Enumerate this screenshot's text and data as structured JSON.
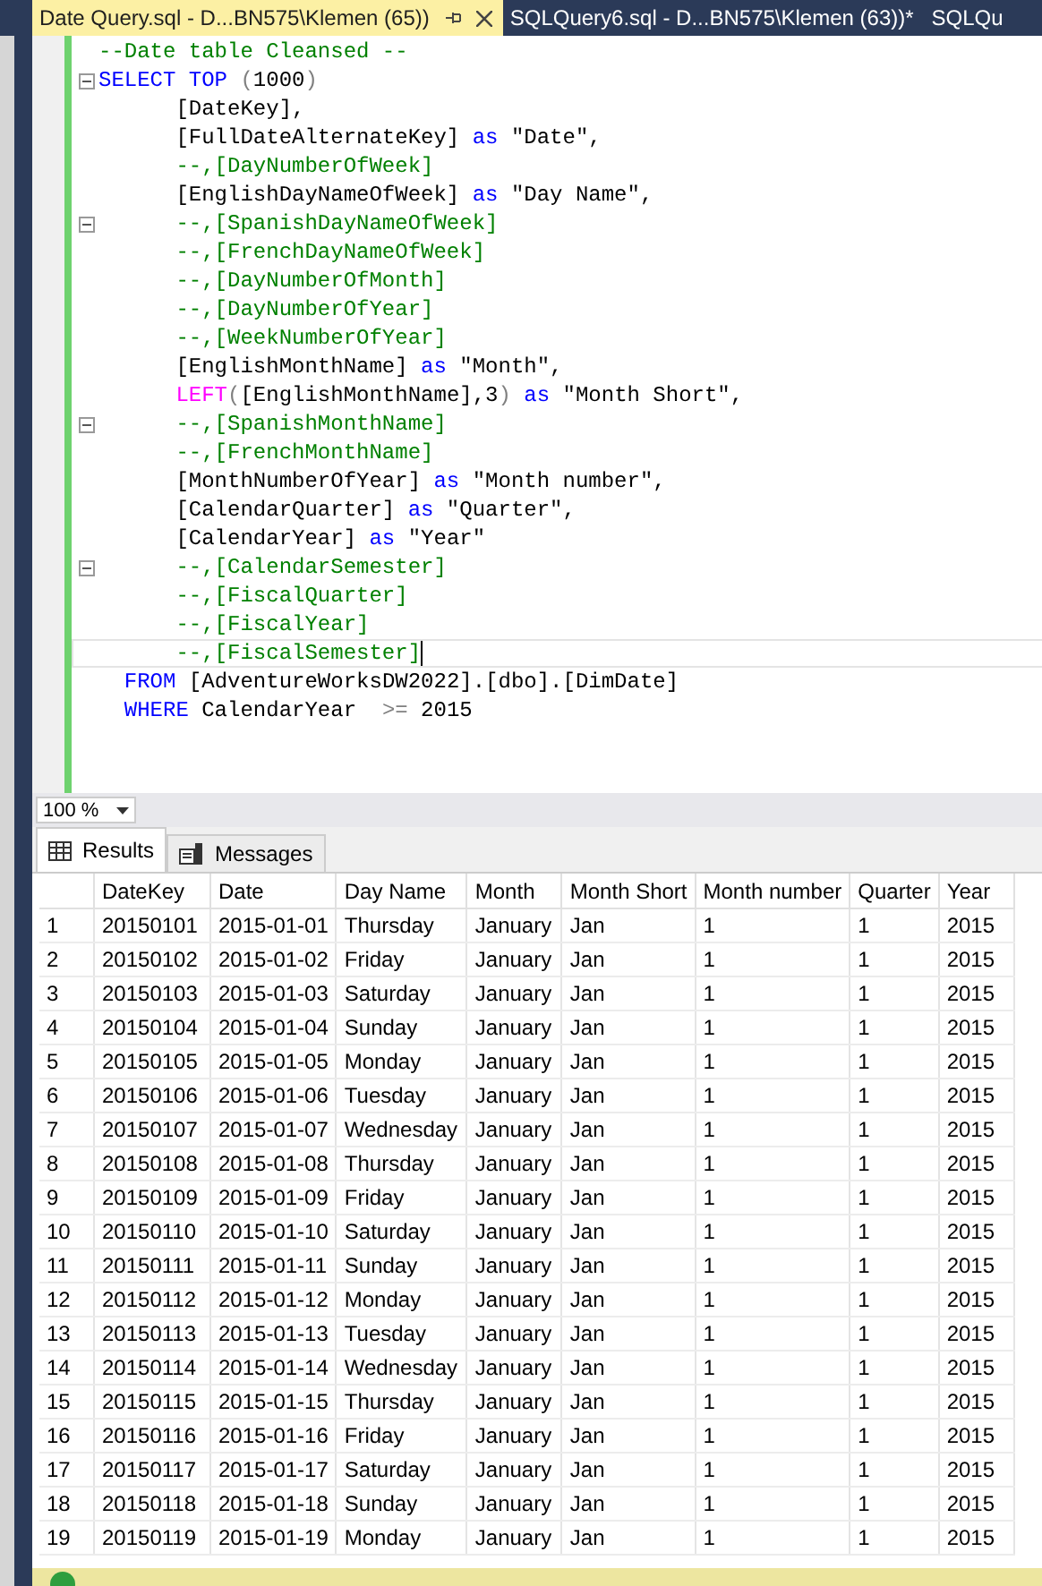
{
  "tabs": [
    {
      "label": "Date Query.sql - D...BN575\\Klemen (65))",
      "selected": true
    },
    {
      "label": "SQLQuery6.sql - D...BN575\\Klemen (63))*",
      "selected": false
    },
    {
      "label": "SQLQu",
      "selected": false
    }
  ],
  "editor": {
    "lines": [
      {
        "fold": false,
        "current": false,
        "segments": [
          {
            "kind": "comment",
            "text": "--Date table Cleansed --"
          }
        ]
      },
      {
        "fold": true,
        "current": false,
        "segments": [
          {
            "kind": "keyword",
            "text": "SELECT TOP "
          },
          {
            "kind": "op",
            "text": "("
          },
          {
            "kind": "text",
            "text": "1000"
          },
          {
            "kind": "op",
            "text": ")"
          }
        ]
      },
      {
        "fold": false,
        "current": false,
        "segments": [
          {
            "kind": "text",
            "text": "      [DateKey],"
          }
        ]
      },
      {
        "fold": false,
        "current": false,
        "segments": [
          {
            "kind": "text",
            "text": "      [FullDateAlternateKey] "
          },
          {
            "kind": "keyword",
            "text": "as"
          },
          {
            "kind": "text",
            "text": " \"Date\","
          }
        ]
      },
      {
        "fold": false,
        "current": false,
        "segments": [
          {
            "kind": "comment",
            "text": "      --,[DayNumberOfWeek]"
          }
        ]
      },
      {
        "fold": false,
        "current": false,
        "segments": [
          {
            "kind": "text",
            "text": "      [EnglishDayNameOfWeek] "
          },
          {
            "kind": "keyword",
            "text": "as"
          },
          {
            "kind": "text",
            "text": " \"Day Name\","
          }
        ]
      },
      {
        "fold": true,
        "current": false,
        "segments": [
          {
            "kind": "comment",
            "text": "      --,[SpanishDayNameOfWeek]"
          }
        ]
      },
      {
        "fold": false,
        "current": false,
        "segments": [
          {
            "kind": "comment",
            "text": "      --,[FrenchDayNameOfWeek]"
          }
        ]
      },
      {
        "fold": false,
        "current": false,
        "segments": [
          {
            "kind": "comment",
            "text": "      --,[DayNumberOfMonth]"
          }
        ]
      },
      {
        "fold": false,
        "current": false,
        "segments": [
          {
            "kind": "comment",
            "text": "      --,[DayNumberOfYear]"
          }
        ]
      },
      {
        "fold": false,
        "current": false,
        "segments": [
          {
            "kind": "comment",
            "text": "      --,[WeekNumberOfYear]"
          }
        ]
      },
      {
        "fold": false,
        "current": false,
        "segments": [
          {
            "kind": "text",
            "text": "      [EnglishMonthName] "
          },
          {
            "kind": "keyword",
            "text": "as"
          },
          {
            "kind": "text",
            "text": " \"Month\","
          }
        ]
      },
      {
        "fold": false,
        "current": false,
        "segments": [
          {
            "kind": "func",
            "text": "      LEFT"
          },
          {
            "kind": "op",
            "text": "("
          },
          {
            "kind": "text",
            "text": "[EnglishMonthName],3"
          },
          {
            "kind": "op",
            "text": ")"
          },
          {
            "kind": "keyword",
            "text": " as"
          },
          {
            "kind": "text",
            "text": " \"Month Short\","
          }
        ]
      },
      {
        "fold": true,
        "current": false,
        "segments": [
          {
            "kind": "comment",
            "text": "      --,[SpanishMonthName]"
          }
        ]
      },
      {
        "fold": false,
        "current": false,
        "segments": [
          {
            "kind": "comment",
            "text": "      --,[FrenchMonthName]"
          }
        ]
      },
      {
        "fold": false,
        "current": false,
        "segments": [
          {
            "kind": "text",
            "text": "      [MonthNumberOfYear] "
          },
          {
            "kind": "keyword",
            "text": "as"
          },
          {
            "kind": "text",
            "text": " \"Month number\","
          }
        ]
      },
      {
        "fold": false,
        "current": false,
        "segments": [
          {
            "kind": "text",
            "text": "      [CalendarQuarter] "
          },
          {
            "kind": "keyword",
            "text": "as"
          },
          {
            "kind": "text",
            "text": " \"Quarter\","
          }
        ]
      },
      {
        "fold": false,
        "current": false,
        "segments": [
          {
            "kind": "text",
            "text": "      [CalendarYear] "
          },
          {
            "kind": "keyword",
            "text": "as"
          },
          {
            "kind": "text",
            "text": " \"Year\""
          }
        ]
      },
      {
        "fold": true,
        "current": false,
        "segments": [
          {
            "kind": "comment",
            "text": "      --,[CalendarSemester]"
          }
        ]
      },
      {
        "fold": false,
        "current": false,
        "segments": [
          {
            "kind": "comment",
            "text": "      --,[FiscalQuarter]"
          }
        ]
      },
      {
        "fold": false,
        "current": false,
        "segments": [
          {
            "kind": "comment",
            "text": "      --,[FiscalYear]"
          }
        ]
      },
      {
        "fold": false,
        "current": true,
        "segments": [
          {
            "kind": "comment",
            "text": "      --,[FiscalSemester]"
          }
        ]
      },
      {
        "fold": false,
        "current": false,
        "segments": [
          {
            "kind": "keyword",
            "text": "  FROM "
          },
          {
            "kind": "text",
            "text": "[AdventureWorksDW2022].[dbo].[DimDate]"
          }
        ]
      },
      {
        "fold": false,
        "current": false,
        "segments": [
          {
            "kind": "keyword",
            "text": "  WHERE "
          },
          {
            "kind": "text",
            "text": "CalendarYear  "
          },
          {
            "kind": "op",
            "text": ">="
          },
          {
            "kind": "text",
            "text": " 2015"
          }
        ]
      }
    ]
  },
  "zoom": {
    "value": "100 %"
  },
  "result_tabs": [
    {
      "label": "Results",
      "kind": "grid",
      "selected": true
    },
    {
      "label": "Messages",
      "kind": "messages",
      "selected": false
    }
  ],
  "table": {
    "columns": [
      "",
      "DateKey",
      "Date",
      "Day Name",
      "Month",
      "Month Short",
      "Month number",
      "Quarter",
      "Year"
    ],
    "rows": [
      [
        "1",
        "20150101",
        "2015-01-01",
        "Thursday",
        "January",
        "Jan",
        "1",
        "1",
        "2015"
      ],
      [
        "2",
        "20150102",
        "2015-01-02",
        "Friday",
        "January",
        "Jan",
        "1",
        "1",
        "2015"
      ],
      [
        "3",
        "20150103",
        "2015-01-03",
        "Saturday",
        "January",
        "Jan",
        "1",
        "1",
        "2015"
      ],
      [
        "4",
        "20150104",
        "2015-01-04",
        "Sunday",
        "January",
        "Jan",
        "1",
        "1",
        "2015"
      ],
      [
        "5",
        "20150105",
        "2015-01-05",
        "Monday",
        "January",
        "Jan",
        "1",
        "1",
        "2015"
      ],
      [
        "6",
        "20150106",
        "2015-01-06",
        "Tuesday",
        "January",
        "Jan",
        "1",
        "1",
        "2015"
      ],
      [
        "7",
        "20150107",
        "2015-01-07",
        "Wednesday",
        "January",
        "Jan",
        "1",
        "1",
        "2015"
      ],
      [
        "8",
        "20150108",
        "2015-01-08",
        "Thursday",
        "January",
        "Jan",
        "1",
        "1",
        "2015"
      ],
      [
        "9",
        "20150109",
        "2015-01-09",
        "Friday",
        "January",
        "Jan",
        "1",
        "1",
        "2015"
      ],
      [
        "10",
        "20150110",
        "2015-01-10",
        "Saturday",
        "January",
        "Jan",
        "1",
        "1",
        "2015"
      ],
      [
        "11",
        "20150111",
        "2015-01-11",
        "Sunday",
        "January",
        "Jan",
        "1",
        "1",
        "2015"
      ],
      [
        "12",
        "20150112",
        "2015-01-12",
        "Monday",
        "January",
        "Jan",
        "1",
        "1",
        "2015"
      ],
      [
        "13",
        "20150113",
        "2015-01-13",
        "Tuesday",
        "January",
        "Jan",
        "1",
        "1",
        "2015"
      ],
      [
        "14",
        "20150114",
        "2015-01-14",
        "Wednesday",
        "January",
        "Jan",
        "1",
        "1",
        "2015"
      ],
      [
        "15",
        "20150115",
        "2015-01-15",
        "Thursday",
        "January",
        "Jan",
        "1",
        "1",
        "2015"
      ],
      [
        "16",
        "20150116",
        "2015-01-16",
        "Friday",
        "January",
        "Jan",
        "1",
        "1",
        "2015"
      ],
      [
        "17",
        "20150117",
        "2015-01-17",
        "Saturday",
        "January",
        "Jan",
        "1",
        "1",
        "2015"
      ],
      [
        "18",
        "20150118",
        "2015-01-18",
        "Sunday",
        "January",
        "Jan",
        "1",
        "1",
        "2015"
      ],
      [
        "19",
        "20150119",
        "2015-01-19",
        "Monday",
        "January",
        "Jan",
        "1",
        "1",
        "2015"
      ]
    ]
  }
}
